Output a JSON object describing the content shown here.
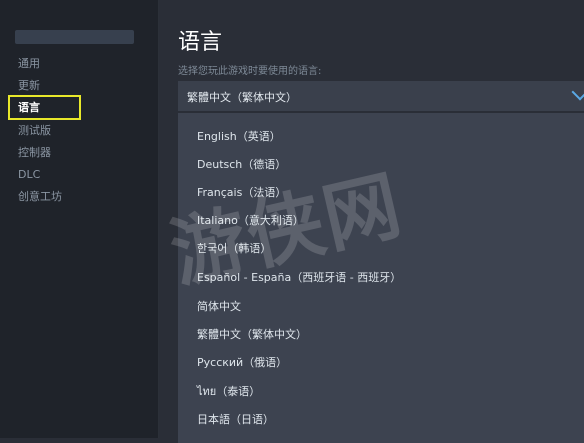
{
  "sidebar": {
    "items": [
      {
        "label": "通用"
      },
      {
        "label": "更新"
      },
      {
        "label": "语言"
      },
      {
        "label": "测试版"
      },
      {
        "label": "控制器"
      },
      {
        "label": "DLC"
      },
      {
        "label": "创意工坊"
      }
    ],
    "active_index": 2
  },
  "main": {
    "title": "语言",
    "subtitle": "选择您玩此游戏时要使用的语言:",
    "select": {
      "value": "繁體中文（繁体中文）"
    },
    "options": [
      "English（英语）",
      "Deutsch（德语）",
      "Français（法语）",
      "Italiano（意大利语）",
      "한국어（韩语）",
      "Español - España（西班牙语 - 西班牙）",
      "简体中文",
      "繁體中文（繁体中文）",
      "Русский（俄语）",
      "ไทย（泰语）",
      "日本語（日语）"
    ]
  },
  "watermark": "游侠网",
  "colors": {
    "highlight": "#e8e82a",
    "accent": "#5aa9e6"
  }
}
